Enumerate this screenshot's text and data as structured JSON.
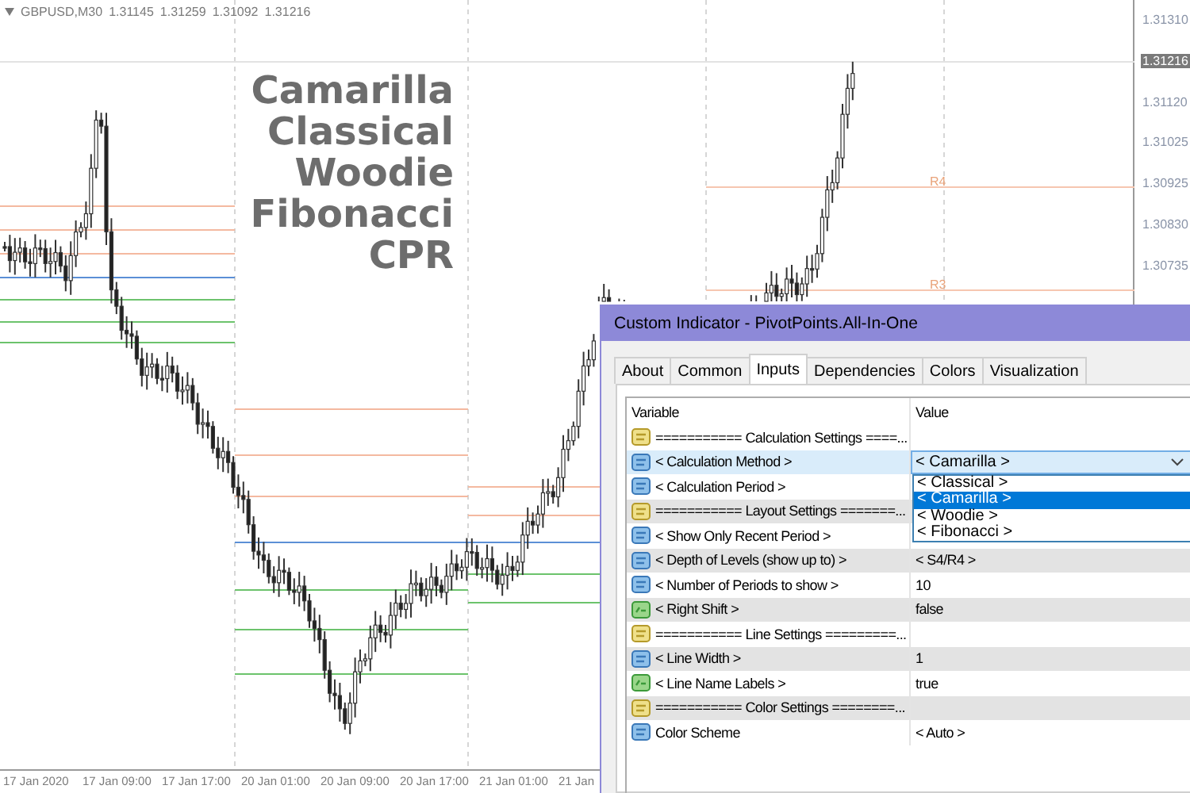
{
  "chart": {
    "symbol": "GBPUSD,M30",
    "quotes": [
      "1.31145",
      "1.31259",
      "1.31092",
      "1.31216"
    ],
    "overlay_lines": [
      "Camarilla",
      "Classical",
      "Woodie",
      "Fibonacci",
      "CPR"
    ],
    "level_labels": [
      "R4",
      "R3"
    ],
    "price_axis": [
      {
        "label": "1.31310",
        "current": false
      },
      {
        "label": "1.31216",
        "current": true
      },
      {
        "label": "1.31120",
        "current": false
      },
      {
        "label": "1.31025",
        "current": false
      },
      {
        "label": "1.30925",
        "current": false
      },
      {
        "label": "1.30830",
        "current": false
      },
      {
        "label": "1.30735",
        "current": false
      }
    ],
    "time_axis": [
      "17 Jan 2020",
      "17 Jan 09:00",
      "17 Jan 17:00",
      "20 Jan 01:00",
      "20 Jan 09:00",
      "20 Jan 17:00",
      "21 Jan 01:00",
      "21 Jan"
    ]
  },
  "dialog": {
    "title": "Custom Indicator - PivotPoints.All-In-One",
    "tabs": [
      {
        "label": "About",
        "selected": false
      },
      {
        "label": "Common",
        "selected": false
      },
      {
        "label": "Inputs",
        "selected": true
      },
      {
        "label": "Dependencies",
        "selected": false
      },
      {
        "label": "Colors",
        "selected": false
      },
      {
        "label": "Visualization",
        "selected": false
      }
    ],
    "columns": [
      "Variable",
      "Value"
    ],
    "rows": [
      {
        "kind": "string",
        "name": "=========== Calculation Settings ====...",
        "selected": false
      },
      {
        "kind": "integer",
        "name": "< Calculation Method >",
        "value": "< Camarilla >",
        "selected": true,
        "open": true,
        "options": [
          {
            "label": "< Classical >",
            "selected": false
          },
          {
            "label": "< Camarilla >",
            "selected": true
          },
          {
            "label": "< Woodie >",
            "selected": false
          },
          {
            "label": "< Fibonacci >",
            "selected": false
          }
        ]
      },
      {
        "kind": "integer",
        "name": "< Calculation Period >",
        "selected": false
      },
      {
        "kind": "string",
        "name": "=========== Layout Settings =======...",
        "selected": false
      },
      {
        "kind": "integer",
        "name": "< Show Only Recent Period >",
        "selected": false
      },
      {
        "kind": "integer",
        "name": "< Depth of Levels (show up to) >",
        "value": "< S4/R4 >",
        "selected": false
      },
      {
        "kind": "integer",
        "name": "< Number of Periods to show >",
        "value": "10",
        "selected": false
      },
      {
        "kind": "bool",
        "name": "< Right Shift >",
        "value": "false",
        "selected": false
      },
      {
        "kind": "string",
        "name": "=========== Line Settings =========...",
        "selected": false
      },
      {
        "kind": "integer",
        "name": "< Line Width >",
        "value": "1",
        "selected": false
      },
      {
        "kind": "bool",
        "name": "< Line Name Labels >",
        "value": "true",
        "selected": false
      },
      {
        "kind": "string",
        "name": "=========== Color Settings ========...",
        "selected": false
      },
      {
        "kind": "integer",
        "name": "Color Scheme",
        "value": "< Auto >",
        "selected": false
      }
    ]
  }
}
